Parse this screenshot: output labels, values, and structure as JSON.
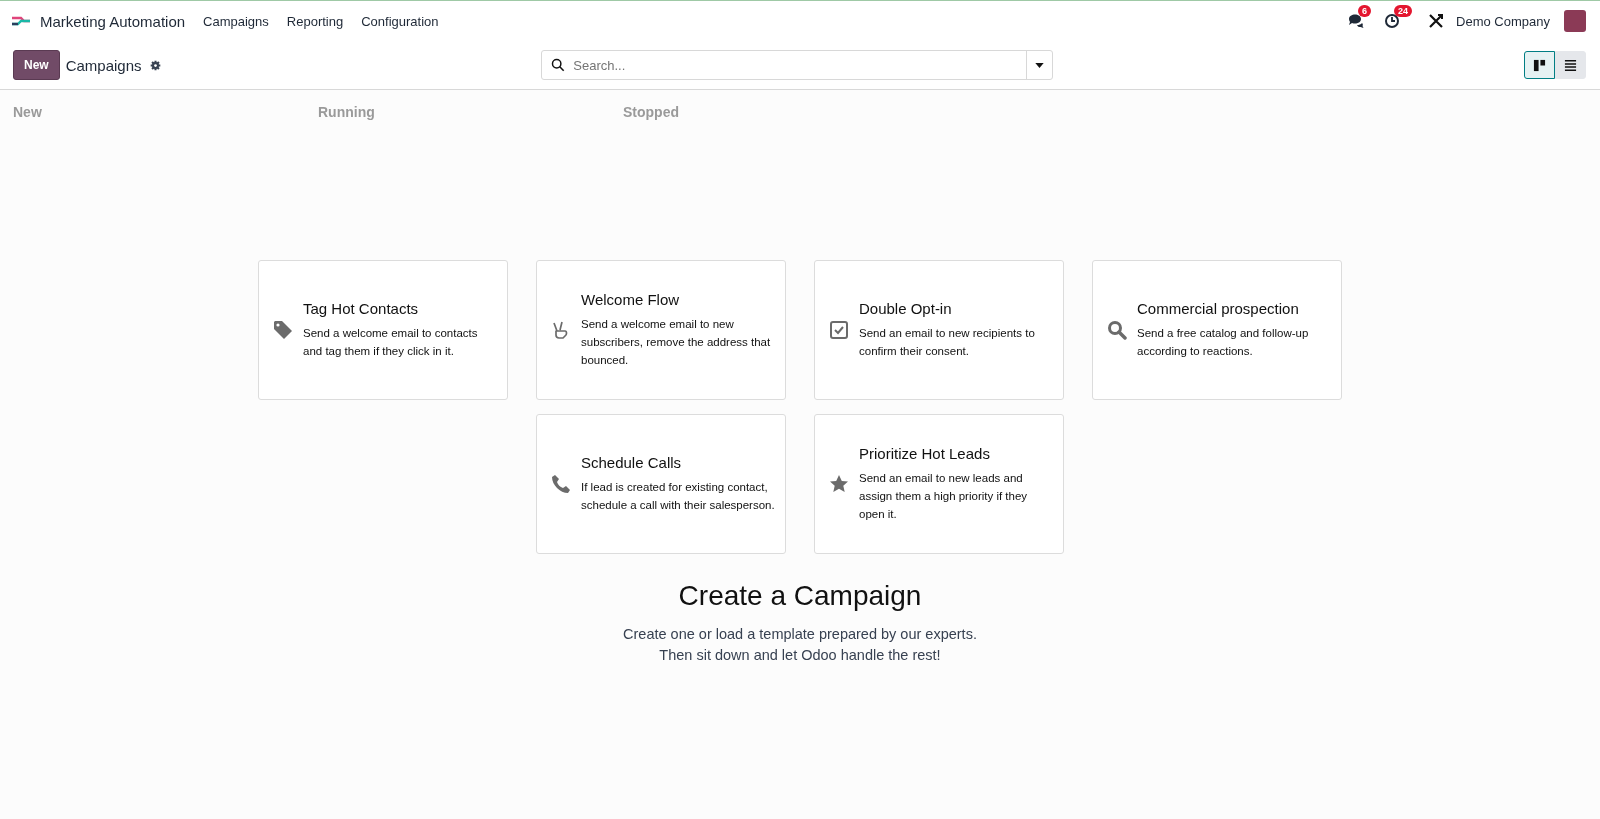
{
  "navbar": {
    "app_name": "Marketing Automation",
    "menu": [
      "Campaigns",
      "Reporting",
      "Configuration"
    ],
    "messages_count": "6",
    "activities_count": "24",
    "company": "Demo Company"
  },
  "control_panel": {
    "new_button": "New",
    "breadcrumb": "Campaigns",
    "search": {
      "placeholder": "Search..."
    },
    "views": [
      {
        "kind": "kanban",
        "selected": true
      },
      {
        "kind": "list",
        "selected": false
      }
    ]
  },
  "stages": [
    "New",
    "Running",
    "Stopped"
  ],
  "templates": [
    [
      {
        "kind": "tag",
        "title": "Tag Hot Contacts",
        "description": "Send a welcome email to contacts and tag them if they click in it."
      },
      {
        "kind": "peace",
        "title": "Welcome Flow",
        "description": "Send a welcome email to new subscribers, remove the address that bounced."
      },
      {
        "kind": "check",
        "title": "Double Opt-in",
        "description": "Send an email to new recipients to confirm their consent."
      },
      {
        "kind": "search",
        "title": "Commercial prospection",
        "description": "Send a free catalog and follow-up according to reactions."
      }
    ],
    [
      {
        "kind": "phone",
        "title": "Schedule Calls",
        "description": "If lead is created for existing contact, schedule a call with their salesperson."
      },
      {
        "kind": "star",
        "title": "Prioritize Hot Leads",
        "description": "Send an email to new leads and assign them a high priority if they open it."
      }
    ]
  ],
  "helper": {
    "title": "Create a Campaign",
    "lines": [
      "Create one or load a template prepared by our experts.",
      "Then sit down and let Odoo handle the rest!"
    ]
  }
}
